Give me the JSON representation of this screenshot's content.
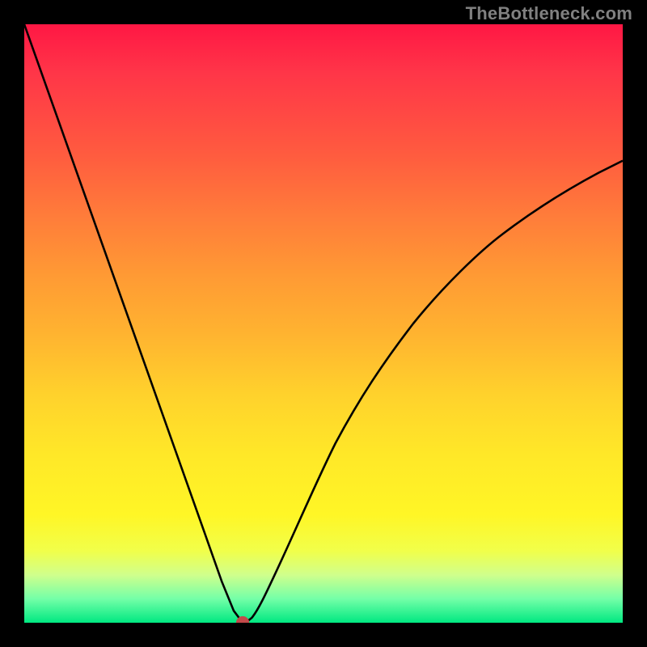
{
  "watermark": "TheBottleneck.com",
  "chart_data": {
    "type": "line",
    "title": "",
    "xlabel": "",
    "ylabel": "",
    "xlim": [
      0,
      100
    ],
    "ylim": [
      0,
      100
    ],
    "grid": false,
    "series": [
      {
        "name": "curve",
        "x": [
          0,
          5,
          10,
          15,
          20,
          25,
          30,
          33,
          35,
          36.5,
          38,
          40,
          43,
          47,
          52,
          58,
          65,
          72,
          80,
          88,
          96,
          100
        ],
        "y": [
          100,
          85.9,
          71.8,
          57.7,
          43.6,
          29.5,
          15.4,
          6.9,
          2.0,
          0.0,
          0.8,
          4.0,
          10.5,
          19.8,
          30.0,
          40.2,
          50.0,
          58.0,
          65.0,
          70.5,
          75.2,
          77.2
        ]
      }
    ],
    "marker": {
      "name": "dot",
      "x": 36.5,
      "y": 0,
      "color": "#c24a4a",
      "r": 1.1
    },
    "background_gradient": {
      "top": "#ff1744",
      "mid": "#ffd22c",
      "bottom": "#00e881"
    },
    "colors": {
      "curve": "#000000",
      "frame": "#000000"
    }
  }
}
